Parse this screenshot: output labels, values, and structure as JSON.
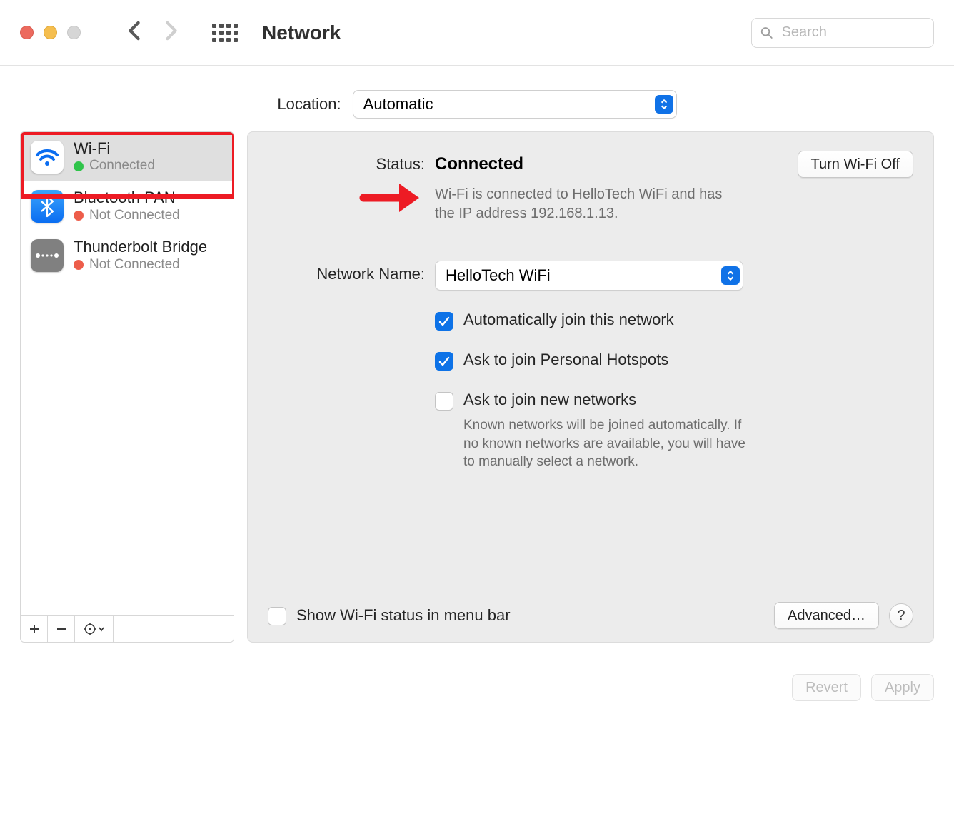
{
  "toolbar": {
    "title": "Network",
    "search_placeholder": "Search"
  },
  "location": {
    "label": "Location:",
    "value": "Automatic"
  },
  "sidebar": {
    "items": [
      {
        "name": "Wi-Fi",
        "status": "Connected",
        "status_color": "green",
        "icon": "wifi",
        "selected": true
      },
      {
        "name": "Bluetooth PAN",
        "status": "Not Connected",
        "status_color": "red",
        "icon": "bluetooth",
        "selected": false
      },
      {
        "name": "Thunderbolt Bridge",
        "status": "Not Connected",
        "status_color": "red",
        "icon": "thunderbolt-bridge",
        "selected": false
      }
    ]
  },
  "detail": {
    "status_label": "Status:",
    "status_value": "Connected",
    "turn_off_label": "Turn Wi-Fi Off",
    "status_description": "Wi-Fi is connected to HelloTech WiFi and has the IP address 192.168.1.13.",
    "network_name_label": "Network Name:",
    "network_name_value": "HelloTech WiFi",
    "auto_join": {
      "checked": true,
      "label": "Automatically join this network"
    },
    "ask_hotspots": {
      "checked": true,
      "label": "Ask to join Personal Hotspots"
    },
    "ask_new": {
      "checked": false,
      "label": "Ask to join new networks",
      "description": "Known networks will be joined automatically. If no known networks are available, you will have to manually select a network."
    },
    "show_menu_bar": {
      "checked": false,
      "label": "Show Wi-Fi status in menu bar"
    },
    "advanced_label": "Advanced…",
    "help_label": "?"
  },
  "footer": {
    "revert_label": "Revert",
    "apply_label": "Apply"
  }
}
